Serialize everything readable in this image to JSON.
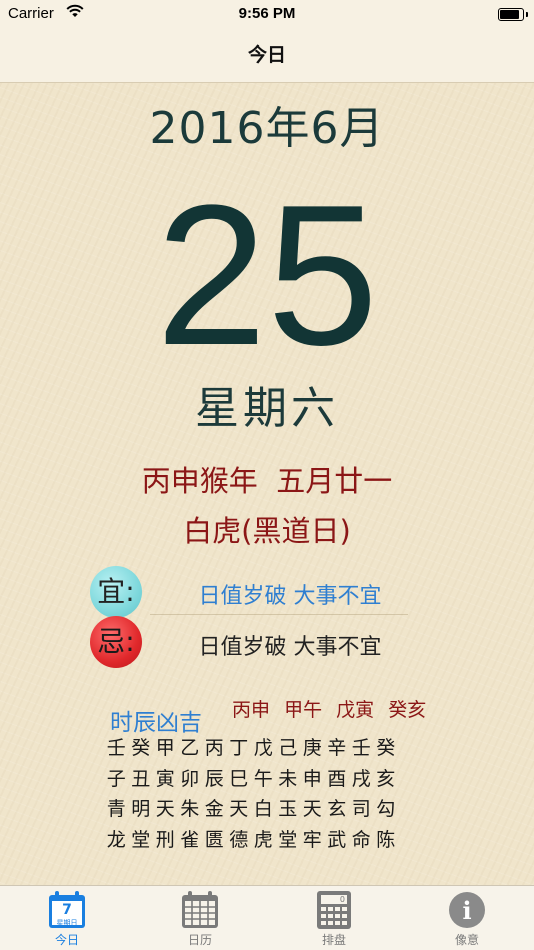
{
  "status_bar": {
    "carrier": "Carrier",
    "time": "9:56 PM",
    "battery_level": 0.95
  },
  "nav": {
    "title": "今日"
  },
  "date": {
    "year_month": "2016年6月",
    "day": "25",
    "weekday": "星期六",
    "lunar": "丙申猴年  五月廿一",
    "deity": "白虎(黑道日)"
  },
  "advice": {
    "yi_label": "宜:",
    "yi_text": "日值岁破 大事不宜",
    "ji_label": "忌:",
    "ji_text": "日值岁破 大事不宜"
  },
  "shichen": {
    "title": "时辰凶吉",
    "ganzhi": [
      "丙申",
      "甲午",
      "戊寅",
      "癸亥"
    ],
    "rows": [
      [
        "壬",
        "癸",
        "甲",
        "乙",
        "丙",
        "丁",
        "戊",
        "己",
        "庚",
        "辛",
        "壬",
        "癸"
      ],
      [
        "子",
        "丑",
        "寅",
        "卯",
        "辰",
        "巳",
        "午",
        "未",
        "申",
        "酉",
        "戌",
        "亥"
      ],
      [
        "青",
        "明",
        "天",
        "朱",
        "金",
        "天",
        "白",
        "玉",
        "天",
        "玄",
        "司",
        "勾"
      ],
      [
        "龙",
        "堂",
        "刑",
        "雀",
        "匮",
        "德",
        "虎",
        "堂",
        "牢",
        "武",
        "命",
        "陈"
      ]
    ]
  },
  "tabs": [
    {
      "label": "今日",
      "icon": "today-calendar-icon",
      "active": true,
      "icon_day": "7",
      "icon_sub": "星期日"
    },
    {
      "label": "日历",
      "icon": "calendar-grid-icon",
      "active": false
    },
    {
      "label": "排盘",
      "icon": "calculator-icon",
      "active": false,
      "icon_value": "0"
    },
    {
      "label": "像意",
      "icon": "info-icon",
      "active": false,
      "icon_glyph": "i"
    }
  ],
  "colors": {
    "accent": "#1a7fe0",
    "red_text": "#8b1616",
    "blue_text": "#2f7fd1",
    "day_text": "#123535"
  }
}
